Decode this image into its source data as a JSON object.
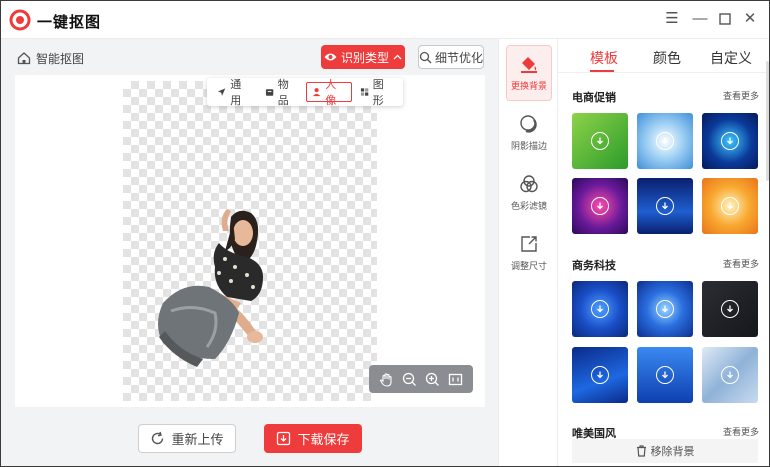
{
  "app": {
    "title": "一键抠图"
  },
  "window": {
    "menu_icon": "menu-icon",
    "minimize_icon": "minimize-icon",
    "maximize_icon": "maximize-icon",
    "close_icon": "close-icon"
  },
  "toolbar": {
    "home_label": "智能抠图",
    "recognize_label": "识别类型",
    "detail_label": "细节优化",
    "types": [
      {
        "label": "通用",
        "icon": "navigation-arrow-icon",
        "active": false
      },
      {
        "label": "物品",
        "icon": "box-icon",
        "active": false
      },
      {
        "label": "人像",
        "icon": "person-icon",
        "active": true
      },
      {
        "label": "图形",
        "icon": "shapes-icon",
        "active": false
      }
    ]
  },
  "actions": {
    "reupload_label": "重新上传",
    "download_label": "下载保存"
  },
  "tools": [
    {
      "label": "更换背景",
      "icon": "paint-bucket-icon",
      "active": true
    },
    {
      "label": "阴影描边",
      "icon": "shadow-icon",
      "active": false
    },
    {
      "label": "色彩滤镜",
      "icon": "color-filter-icon",
      "active": false
    },
    {
      "label": "调整尺寸",
      "icon": "resize-icon",
      "active": false
    }
  ],
  "panel": {
    "tabs": [
      "模板",
      "颜色",
      "自定义"
    ],
    "active_tab": "模板",
    "sections": [
      {
        "title": "电商促销",
        "more": "查看更多"
      },
      {
        "title": "商务科技",
        "more": "查看更多"
      },
      {
        "title": "唯美国风",
        "more": "查看更多"
      }
    ],
    "remove_label": "移除背景"
  },
  "colors": {
    "accent": "#ee3b3b",
    "work_bg": "#f2f3f5"
  }
}
